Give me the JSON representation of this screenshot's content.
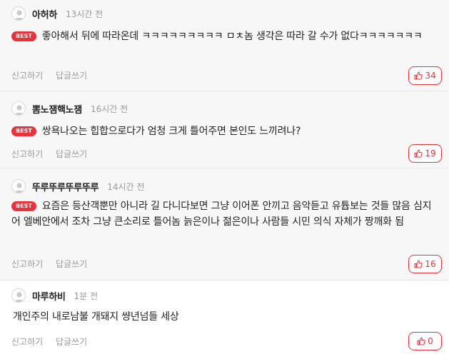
{
  "comments": [
    {
      "name": "아허하",
      "time": "13시간 전",
      "best": true,
      "badge": "BEST",
      "text": "좋아해서 뒤에 따라온데 ㅋㅋㅋㅋㅋㅋㅋㅋㅋ ㅁㅊ놈 생각은 따라 갈 수가 없다ㅋㅋㅋㅋㅋㅋㅋ",
      "report": "신고하기",
      "reply": "답글쓰기",
      "likes": "34"
    },
    {
      "name": "뽐노잼핵노잼",
      "time": "16시간 전",
      "best": true,
      "badge": "BEST",
      "text": "쌍욕나오는 힙합으로다가 엄청 크게 틀어주면 본인도 느끼려나?",
      "report": "신고하기",
      "reply": "답글쓰기",
      "likes": "19"
    },
    {
      "name": "뚜루뚜루뚜루뚜루",
      "time": "14시간 전",
      "best": true,
      "badge": "BEST",
      "text": "요즘은 등산객뿐만 아니라 길 다니다보면 그냥 이어폰 안끼고 음악듣고 유튭보는 것들 많음 심지어 엘베안에서 조차 그냥 큰소리로 틀어놈 늙은이나 젊은이나 사람들 시민 의식 자체가 짱깨화 됨",
      "report": "신고하기",
      "reply": "답글쓰기",
      "likes": "16"
    },
    {
      "name": "마루하비",
      "time": "1분 전",
      "best": false,
      "badge": "",
      "text": "개인주의 내로남불 개돼지 썅년넘들 세상",
      "report": "신고하기",
      "reply": "답글쓰기",
      "likes": "0"
    }
  ],
  "icons": {
    "avatar": "user-avatar-icon",
    "like": "thumbs-up-icon"
  },
  "colors": {
    "accent": "#e8323c",
    "best_bg": "#f7f7f7",
    "muted": "#9a9a9a"
  }
}
